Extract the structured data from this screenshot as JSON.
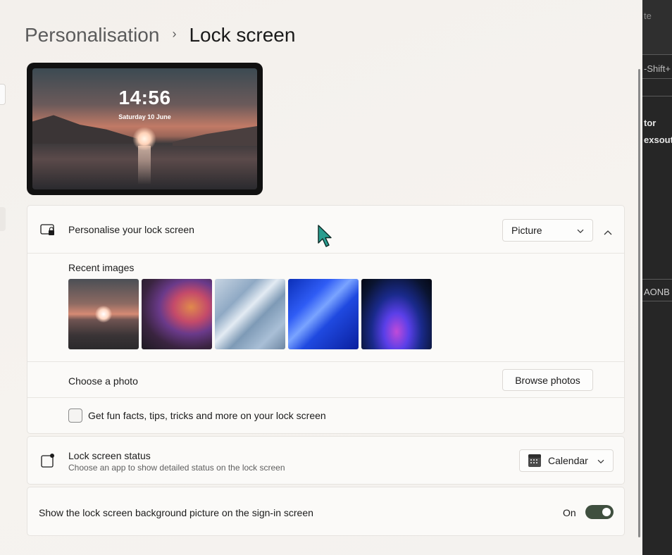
{
  "breadcrumb": {
    "parent": "Personalisation",
    "separator": "›",
    "current": "Lock screen"
  },
  "preview": {
    "time": "14:56",
    "date": "Saturday 10 June"
  },
  "personalise": {
    "label": "Personalise your lock screen",
    "dropdown_value": "Picture",
    "recent_images_label": "Recent images",
    "choose_photo_label": "Choose a photo",
    "browse_button": "Browse photos",
    "fun_facts_label": "Get fun facts, tips, tricks and more on your lock screen",
    "fun_facts_checked": false
  },
  "status": {
    "label": "Lock screen status",
    "description": "Choose an app to show detailed status on the lock screen",
    "dropdown_value": "Calendar"
  },
  "signin": {
    "label": "Show the lock screen background picture on the sign-in screen",
    "toggle_state": "On",
    "toggle_on": true
  },
  "background_window": {
    "texts": [
      "te",
      "-Shift+",
      "tor",
      "exsout",
      "AONB F"
    ]
  },
  "colors": {
    "toggle": "#3f4f3f",
    "cursor": "#2a9d8f"
  }
}
